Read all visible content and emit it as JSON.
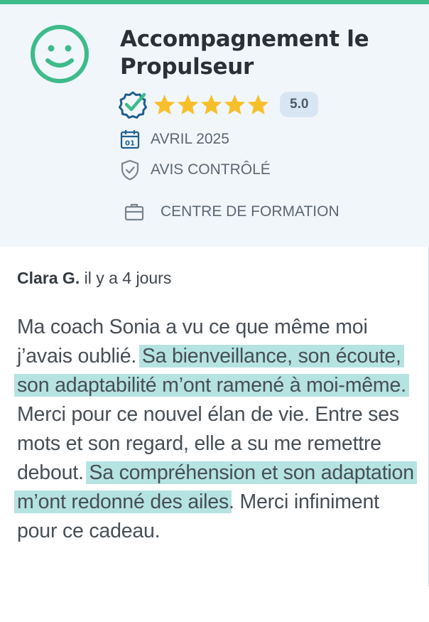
{
  "colors": {
    "accent": "#3dbb8a",
    "header_bg": "#f1f6fb",
    "star": "#f7c02b",
    "highlight": "#b5e3e1",
    "verified_icon": "#1f5f8f"
  },
  "header": {
    "title": "Accompagnement le Propulseur",
    "rating_value": "5.0",
    "stars": 5,
    "date": "AVRIL 2025",
    "date_icon_text": "01",
    "verified_label": "AVIS CONTRÔLÉ",
    "category": "CENTRE DE FORMATION",
    "icons": [
      "smiley-icon",
      "verified-check-icon",
      "star-icon",
      "calendar-icon",
      "shield-check-icon",
      "briefcase-icon"
    ]
  },
  "review": {
    "author": "Clara G.",
    "time_ago": "il y a 4 jours",
    "segments": [
      {
        "text": "Ma coach Sonia a vu ce que même moi j’avais oublié. ",
        "highlight": false
      },
      {
        "text": "Sa bienveillance, son écoute, son adaptabilité m’ont ramené à moi-même.",
        "highlight": true
      },
      {
        "text": " Merci pour ce nouvel élan de vie. Entre ses mots et son regard, elle a su me remettre debout. ",
        "highlight": false
      },
      {
        "text": "Sa compréhension et son adaptation m’ont redonné des ailes",
        "highlight": true
      },
      {
        "text": ". Merci infiniment pour ce cadeau.",
        "highlight": false
      }
    ]
  }
}
